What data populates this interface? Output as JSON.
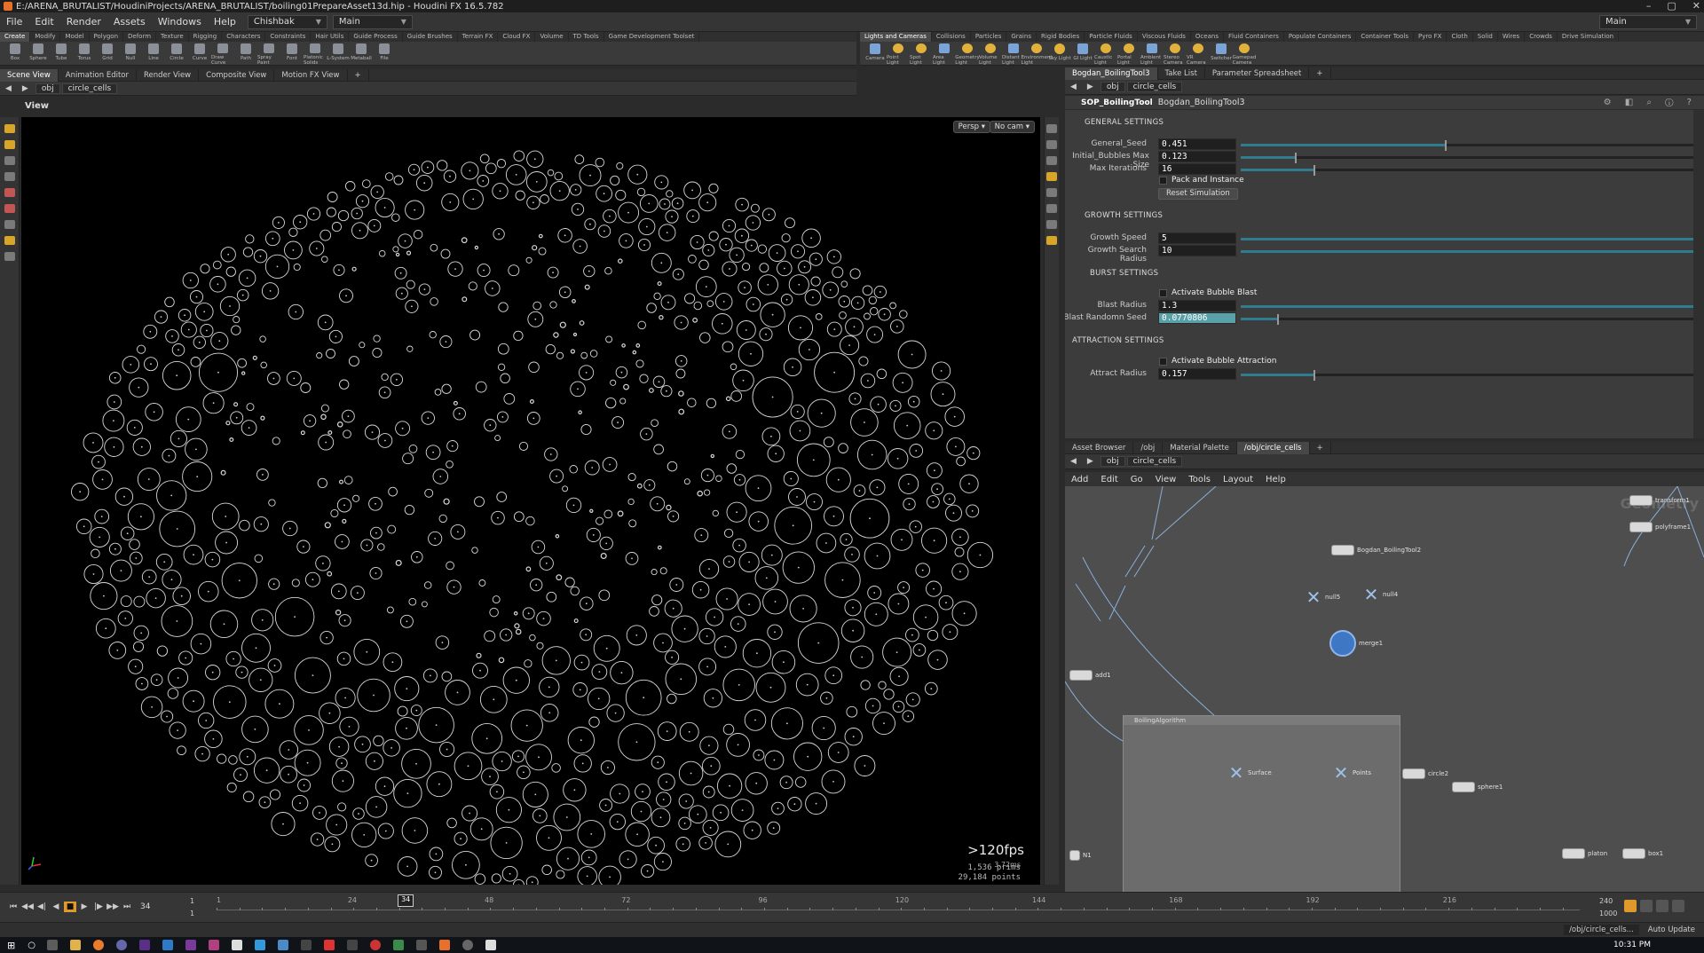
{
  "window": {
    "title": "E:/ARENA_BRUTALIST/HoudiniProjects/ARENA_BRUTALIST/boiling01PrepareAsset13d.hip - Houdini FX 16.5.782",
    "controls": [
      "–",
      "▢",
      "✕"
    ]
  },
  "menubar": {
    "items": [
      "File",
      "Edit",
      "Render",
      "Assets",
      "Windows",
      "Help"
    ],
    "desktop_combo": "Chishbak",
    "workspace_combo": "Main",
    "right_combo": "Main"
  },
  "shelf_left": {
    "tabs": [
      "Create",
      "Modify",
      "Model",
      "Polygon",
      "Deform",
      "Texture",
      "Rigging",
      "Characters",
      "Constraints",
      "Hair Utils",
      "Guide Process",
      "Guide Brushes",
      "Terrain FX",
      "Cloud FX",
      "Volume",
      "TD Tools",
      "Game Development Toolset"
    ],
    "tools": [
      "Box",
      "Sphere",
      "Tube",
      "Torus",
      "Grid",
      "Null",
      "Line",
      "Circle",
      "Curve",
      "Draw Curve",
      "Path",
      "Spray Paint",
      "Font",
      "Platonic Solids",
      "L-System",
      "Metaball",
      "File"
    ]
  },
  "shelf_right": {
    "tabs": [
      "Lights and Cameras",
      "Collisions",
      "Particles",
      "Grains",
      "Rigid Bodies",
      "Particle Fluids",
      "Viscous Fluids",
      "Oceans",
      "Fluid Containers",
      "Populate Containers",
      "Container Tools",
      "Pyro FX",
      "Cloth",
      "Solid",
      "Wires",
      "Crowds",
      "Drive Simulation"
    ],
    "tools": [
      "Camera",
      "Point Light",
      "Spot Light",
      "Area Light",
      "Geometry Light",
      "Volume Light",
      "Distant Light",
      "Environment Light",
      "Sky Light",
      "GI Light",
      "Caustic Light",
      "Portal Light",
      "Ambient Light",
      "Stereo Camera",
      "VR Camera",
      "Switcher",
      "Gamepad Camera"
    ]
  },
  "left_pane": {
    "tabs": [
      "Scene View",
      "Animation Editor",
      "Render View",
      "Composite View",
      "Motion FX View"
    ],
    "path_root": "obj",
    "path_node": "circle_cells",
    "view_label": "View",
    "persp_btn": "Persp",
    "cam_btn": "No cam",
    "fps": ">120fps",
    "ms": "3.72ms",
    "prims_value": "1,536",
    "prims_label": "prims",
    "points_value": "29,184",
    "points_label": "points"
  },
  "param_pane": {
    "tabs": [
      "Bogdan_BoilingTool3",
      "Take List",
      "Parameter Spreadsheet"
    ],
    "path_root": "obj",
    "path_node": "circle_cells",
    "node_type": "SOP_BoilingTool",
    "node_name": "Bogdan_BoilingTool3",
    "sections": {
      "general": "GENERAL SETTINGS",
      "growth": "GROWTH SETTINGS",
      "burst": "BURST SETTINGS",
      "attraction": "ATTRACTION SETTINGS"
    },
    "general_seed": {
      "label": "General_Seed",
      "value": "0.451",
      "level": 0.45
    },
    "initial_bubbles": {
      "label": "Initial_Bubbles Max Size",
      "value": "0.123",
      "level": 0.12
    },
    "max_iterations": {
      "label": "Max Iterations",
      "value": "16",
      "level": 0.16
    },
    "pack_instance": "Pack and Instance",
    "reset_simulation": "Reset Simulation",
    "growth_speed": {
      "label": "Growth Speed",
      "value": "5",
      "level": 1.0
    },
    "growth_search_radius": {
      "label": "Growth Search Radius",
      "value": "10",
      "level": 1.0
    },
    "activate_blast": "Activate Bubble Blast",
    "blast_radius": {
      "label": "Blast Radius",
      "value": "1.3",
      "level": 1.0
    },
    "blast_random_seed": {
      "label": "Blast Randomn Seed",
      "value": "0.0770806",
      "level": 0.08
    },
    "activate_attraction": "Activate Bubble Attraction",
    "attract_radius": {
      "label": "Attract Radius",
      "value": "0.157",
      "level": 0.16
    }
  },
  "network_pane": {
    "tabs": [
      "Asset Browser",
      "/obj",
      "Material Palette",
      "/obj/circle_cells"
    ],
    "path_root": "obj",
    "path_node": "circle_cells",
    "menu": [
      "Add",
      "Edit",
      "Go",
      "View",
      "Tools",
      "Layout",
      "Help"
    ],
    "watermark": "Geometry",
    "nodes": {
      "boiling_tool": "Bogdan_BoilingTool2",
      "null5": "null5",
      "null4": "null4",
      "merge1": "merge1",
      "add1": "add1",
      "boiling_box": "BoilingAlgorithm",
      "surface": "Surface",
      "points": "Points",
      "circle2": "circle2",
      "sphere1": "sphere1",
      "transform": "transform1",
      "polyframe": "polyframe1",
      "platon": "platon",
      "box1": "box1",
      "n1": "N1"
    }
  },
  "timeline": {
    "current_frame": "34",
    "start_a": "1",
    "start_b": "1",
    "end_a": "240",
    "end_b": "1000",
    "ticks": [
      "1",
      "24",
      "48",
      "72",
      "96",
      "120",
      "144",
      "168",
      "192",
      "216"
    ],
    "playhead": "34"
  },
  "statusbar": {
    "path": "/obj/circle_cells...",
    "auto_update": "Auto Update"
  },
  "taskbar": {
    "time": "10:31 PM"
  }
}
